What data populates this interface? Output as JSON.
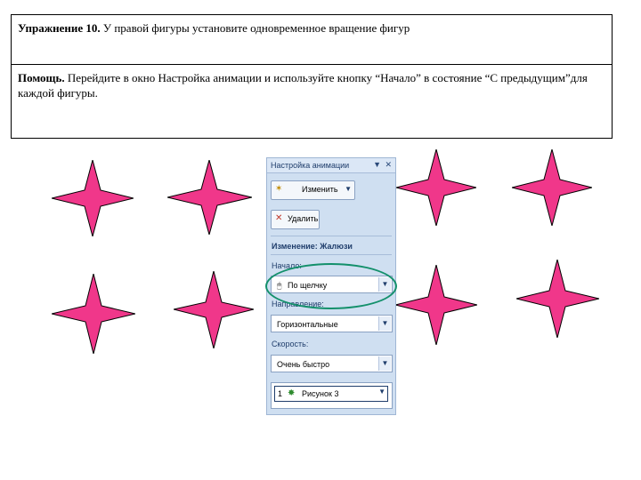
{
  "exercise": {
    "title_bold": "Упражнение 10.",
    "title_text": " У правой фигуры установите одновременное вращение фигур",
    "help_bold": "Помощь.",
    "help_text": " Перейдите в окно Настройка анимации и используйте кнопку “Начало” в состояние “С предыдущим”для каждой фигуры."
  },
  "panel": {
    "title": "Настройка анимации",
    "dropdown_ctl": "▼",
    "close_ctl": "✕",
    "change_button": "Изменить",
    "delete_button": "Удалить",
    "effect_heading": "Изменение: Жалюзи",
    "start_label": "Начало:",
    "start_value": "По щелчку",
    "direction_label": "Направление:",
    "direction_value": "Горизонтальные",
    "speed_label": "Скорость:",
    "speed_value": "Очень быстро",
    "list_item": {
      "number": "1",
      "label": "Рисунок 3"
    }
  },
  "colors": {
    "star_fill": "#f0378a",
    "highlight_ellipse": "#13906b"
  },
  "icons": [
    "star-shape-icon",
    "change-effect-icon",
    "delete-icon",
    "dropdown-arrow-icon",
    "mouse-icon",
    "close-icon"
  ]
}
